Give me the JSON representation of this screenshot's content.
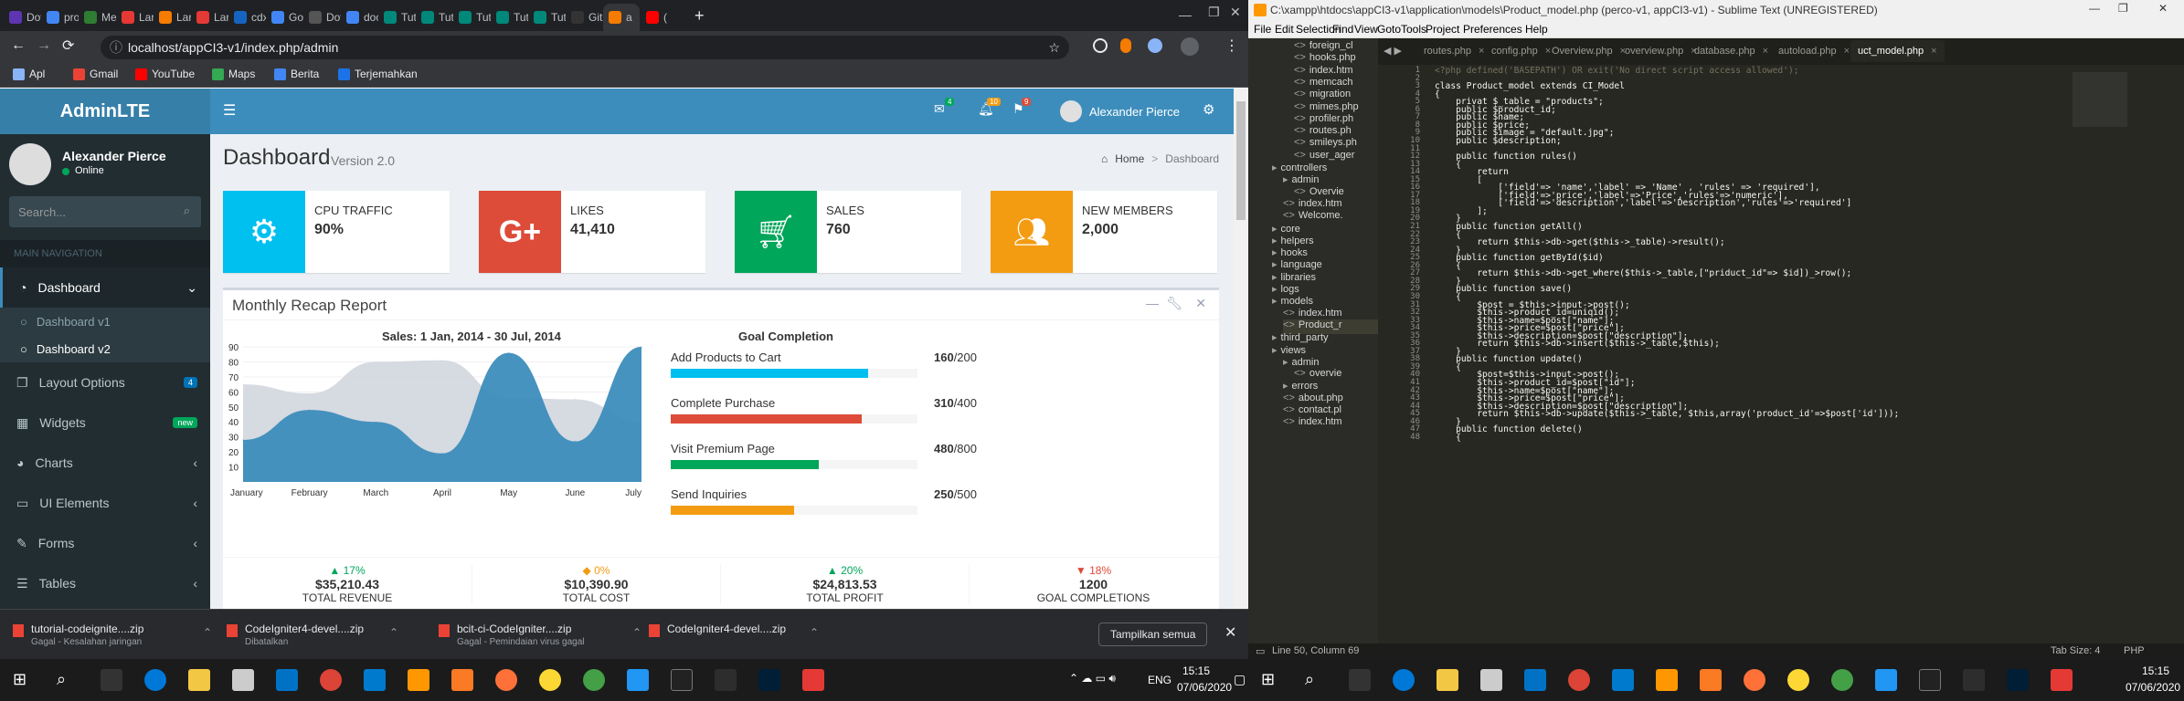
{
  "browser": {
    "tabs": [
      "Dov",
      "proj",
      "Me:",
      "Lara",
      "Lara",
      "Lara",
      "cdx",
      "Goo",
      "Dov",
      "doc",
      "Tuto",
      "Tuto",
      "Tuto",
      "Tuto",
      "Tuto",
      "Git",
      "a",
      "("
    ],
    "url": "localhost/appCI3-v1/index.php/admin",
    "bookmarks": [
      "Apl",
      "Gmail",
      "YouTube",
      "Maps",
      "Berita",
      "Terjemahkan"
    ]
  },
  "admin": {
    "logo": "AdminLTE",
    "user_name": "Alexander Pierce",
    "user_status": "Online",
    "search_placeholder": "Search...",
    "nav_header": "MAIN NAVIGATION",
    "badges": {
      "messages": "4",
      "notifications": "10",
      "tasks": "9"
    },
    "menu": {
      "dashboard": "Dashboard",
      "dashboard_v1": "Dashboard v1",
      "dashboard_v2": "Dashboard v2",
      "layout": "Layout Options",
      "layout_badge": "4",
      "widgets": "Widgets",
      "widgets_badge": "new",
      "charts": "Charts",
      "ui": "UI Elements",
      "forms": "Forms",
      "tables": "Tables"
    },
    "page_title": "Dashboard",
    "page_version": "Version 2.0",
    "breadcrumb_home": "Home",
    "breadcrumb_current": "Dashboard",
    "infoboxes": [
      {
        "label": "CPU TRAFFIC",
        "value": "90%",
        "color": "#00c0ef"
      },
      {
        "label": "LIKES",
        "value": "41,410",
        "color": "#dd4b39"
      },
      {
        "label": "SALES",
        "value": "760",
        "color": "#00a65a"
      },
      {
        "label": "NEW MEMBERS",
        "value": "2,000",
        "color": "#f39c12"
      }
    ],
    "recap_title": "Monthly Recap Report",
    "sales_title": "Sales: 1 Jan, 2014 - 30 Jul, 2014",
    "goal_title": "Goal Completion",
    "goals": [
      {
        "label": "Add Products to Cart",
        "value": "160",
        "total": "/200",
        "fraction": 0.8,
        "color": "#00c0ef"
      },
      {
        "label": "Complete Purchase",
        "value": "310",
        "total": "/400",
        "fraction": 0.775,
        "color": "#dd4b39"
      },
      {
        "label": "Visit Premium Page",
        "value": "480",
        "total": "/800",
        "fraction": 0.6,
        "color": "#00a65a"
      },
      {
        "label": "Send Inquiries",
        "value": "250",
        "total": "/500",
        "fraction": 0.5,
        "color": "#f39c12"
      }
    ],
    "stats": [
      {
        "pct": "17%",
        "value": "$35,210.43",
        "label": "TOTAL REVENUE",
        "color": "#00a65a",
        "arrow": "▲"
      },
      {
        "pct": "0%",
        "value": "$10,390.90",
        "label": "TOTAL COST",
        "color": "#f39c12",
        "arrow": "◆"
      },
      {
        "pct": "20%",
        "value": "$24,813.53",
        "label": "TOTAL PROFIT",
        "color": "#00a65a",
        "arrow": "▲"
      },
      {
        "pct": "18%",
        "value": "1200",
        "label": "GOAL COMPLETIONS",
        "color": "#dd4b39",
        "arrow": "▼"
      }
    ]
  },
  "chart_data": {
    "type": "area",
    "title": "Sales: 1 Jan, 2014 - 30 Jul, 2014",
    "categories": [
      "January",
      "February",
      "March",
      "April",
      "May",
      "June",
      "July"
    ],
    "ylim": [
      0,
      90
    ],
    "yticks": [
      "90",
      "80",
      "70",
      "60",
      "50",
      "40",
      "30",
      "20",
      "10"
    ],
    "series": [
      {
        "values": [
          65,
          59,
          80,
          81,
          56,
          55,
          40
        ],
        "color": "#d2d6de"
      },
      {
        "values": [
          28,
          48,
          40,
          19,
          86,
          27,
          90
        ],
        "color": "#3c8dbc"
      }
    ]
  },
  "downloads": [
    {
      "name": "tutorial-codeignite....zip",
      "status": "Gagal - Kesalahan jaringan"
    },
    {
      "name": "CodeIgniter4-devel....zip",
      "status": "Dibatalkan"
    },
    {
      "name": "bcit-ci-CodeIgniter....zip",
      "status": "Gagal - Pemindaian virus gagal"
    },
    {
      "name": "CodeIgniter4-devel....zip",
      "status": ""
    }
  ],
  "show_all": "Tampilkan semua",
  "taskbar_left": {
    "lang": "ENG",
    "time": "15:15",
    "date": "07/06/2020"
  },
  "sublime": {
    "title": "C:\\xampp\\htdocs\\appCI3-v1\\application\\models\\Product_model.php (perco-v1, appCI3-v1) - Sublime Text (UNREGISTERED)",
    "menu": [
      "File",
      "Edit",
      "Selection",
      "Find",
      "View",
      "Goto",
      "Tools",
      "Project",
      "Preferences",
      "Help"
    ],
    "tabs": [
      "routes.php",
      "config.php",
      "Overview.php",
      "overview.php",
      "database.php",
      "autoload.php",
      "uct_model.php"
    ],
    "tree": [
      "foreign_cl",
      "hooks.php",
      "index.htm",
      "memcach",
      "migration",
      "mimes.php",
      "profiler.ph",
      "routes.ph",
      "smileys.ph",
      "user_ager",
      "controllers",
      "admin",
      "Overvie",
      "index.htm",
      "Welcome.",
      "core",
      "helpers",
      "hooks",
      "language",
      "libraries",
      "logs",
      "models",
      "index.htm",
      "Product_r",
      "third_party",
      "views",
      "admin",
      "overvie",
      "errors",
      "about.php",
      "contact.pl",
      "index.htm"
    ],
    "status_left": "Line 50, Column 69",
    "status_tab": "Tab Size: 4",
    "status_lang": "PHP",
    "first_line": "<?php defined('BASEPATH') OR exit('No direct script access allowed');",
    "code": [
      "",
      "class Product_model extends CI_Model",
      "{",
      "    privat $_table = \"products\";",
      "    public $product_id;",
      "    public $name;",
      "    public $price;",
      "    public $image = \"default.jpg\";",
      "    public $description;",
      "",
      "    public function rules()",
      "    {",
      "        return",
      "        [",
      "            ['field'=> 'name','label' => 'Name' , 'rules' => 'required'],",
      "            ['field'=>'price','label'=>'Price','rules'=>'numeric'],",
      "            ['field'=>'description','label'=>'Description','rules'=>'required']",
      "        ];",
      "    }",
      "    public function getAll()",
      "    {",
      "        return $this->db->get($this->_table)->result();",
      "    }",
      "    public function getById($id)",
      "    {",
      "        return $this->db->get_where($this->_table,[\"priduct_id\"=> $id])_>row();",
      "    }",
      "    public function save()",
      "    {",
      "        $post = $this->input->post();",
      "        $this->product_id=uniqid();",
      "        $this->name=$post[\"name\"];",
      "        $this->price=$post[\"price\"];",
      "        $this->description=$post[\"description\"];",
      "        return $this->db->insert($this->_table,$this);",
      "    }",
      "    public function update()",
      "    {",
      "        $post=$this->input->post();",
      "        $this->product_id=$post[\"id\"];",
      "        $this->name=$post[\"name\"];",
      "        $this->price=$post[\"price\"];",
      "        $this->description=$post[\"description\"];",
      "        return $this->db->update($this->_table, $this,array('product_id'=>$post['id']));",
      "    }",
      "    public function delete()",
      "    {"
    ],
    "taskbar_time": "15:15",
    "taskbar_date": "07/06/2020"
  }
}
